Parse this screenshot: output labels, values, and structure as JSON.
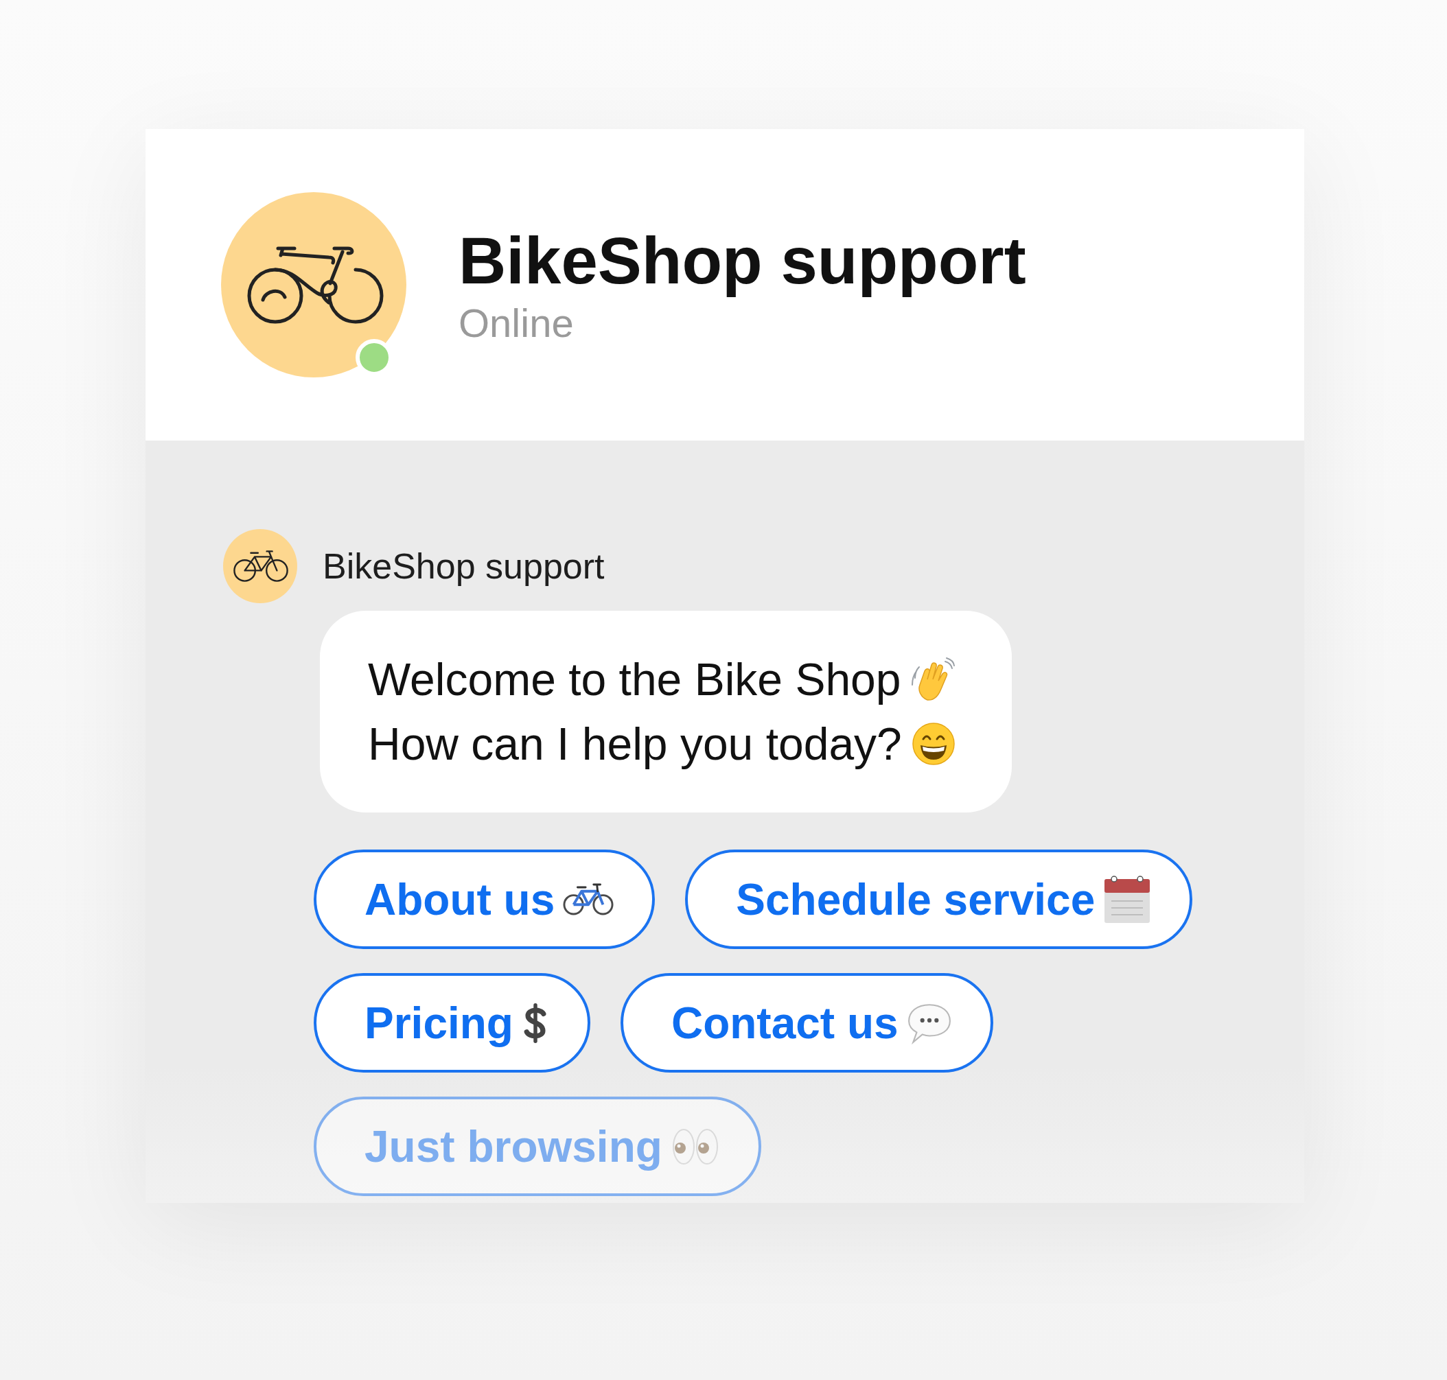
{
  "header": {
    "title": "BikeShop support",
    "status": "Online",
    "online": true
  },
  "messages": [
    {
      "sender": "BikeShop support",
      "lines": [
        "Welcome to the Bike Shop",
        "How can I help you today?"
      ]
    }
  ],
  "quick_replies": [
    {
      "label": "About us",
      "faded": false
    },
    {
      "label": "Schedule service",
      "faded": false
    },
    {
      "label": "Pricing",
      "faded": false
    },
    {
      "label": "Contact us",
      "faded": false
    },
    {
      "label": "Just browsing",
      "faded": true
    }
  ]
}
